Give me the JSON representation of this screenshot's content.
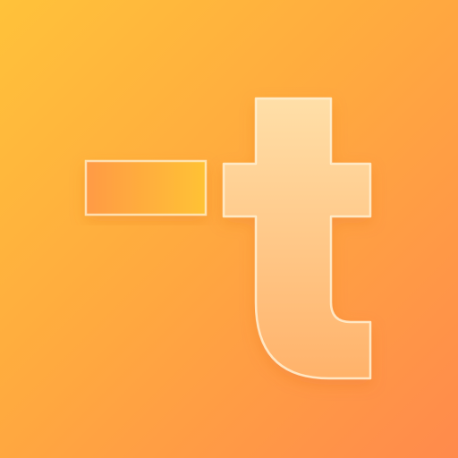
{
  "icon": {
    "name": "app-logo-icon",
    "colors": {
      "background_start": "#ffc23a",
      "background_end": "#ff8a4c",
      "dash_start": "#ff9a45",
      "dash_end": "#ffc235",
      "letter_top": "#ffdfa8",
      "letter_bottom": "#ffb26a",
      "outline": "#fff1d4"
    }
  }
}
